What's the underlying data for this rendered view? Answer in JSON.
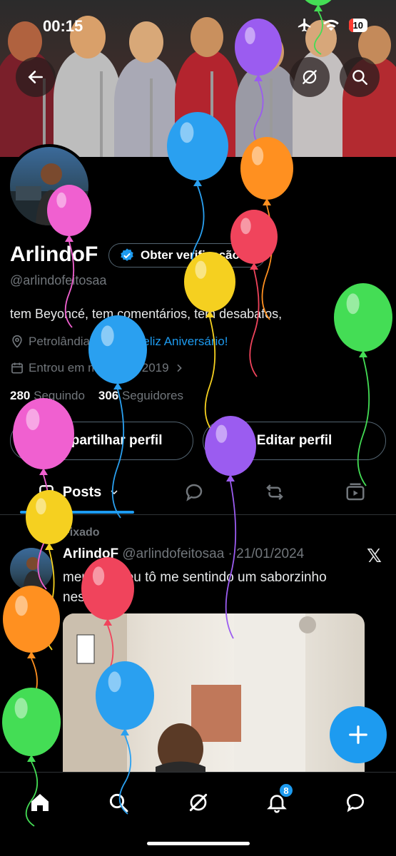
{
  "status_bar": {
    "time": "00:15",
    "battery": "10"
  },
  "profile": {
    "name": "ArlindoF",
    "verify_label": "Obter verificação",
    "handle": "@arlindofeitosaa",
    "bio": "tem Beyoncé, tem comentários, tem desabafos,",
    "location": "Petrolândia",
    "birthday": "Feliz Aniversário!",
    "joined": "Entrou em março de 2019",
    "following_count": "280",
    "following_label": "Seguindo",
    "followers_count": "306",
    "followers_label": "Seguidores"
  },
  "actions": {
    "share": "Compartilhar perfil",
    "edit": "Editar perfil"
  },
  "tabs": {
    "posts": "Posts"
  },
  "post": {
    "pinned_label": "Fixado",
    "author": "ArlindoF",
    "handle_date": "@arlindofeitosaa · 21/01/2024",
    "text": "meu deus eu tô me sentindo um saborzinho nesse"
  },
  "notifications": {
    "badge": "8"
  },
  "colors": {
    "accent": "#1d9bf0",
    "background": "#000000",
    "muted": "#71767b"
  },
  "balloons": [
    {
      "color": "#44dd55"
    },
    {
      "color": "#9b5cf0"
    },
    {
      "color": "#2aa0f0"
    },
    {
      "color": "#ff9020"
    },
    {
      "color": "#f060d0"
    },
    {
      "color": "#f0445c"
    },
    {
      "color": "#f5d020"
    },
    {
      "color": "#44dd55"
    },
    {
      "color": "#2aa0f0"
    },
    {
      "color": "#f060d0"
    },
    {
      "color": "#9b5cf0"
    },
    {
      "color": "#f5d020"
    },
    {
      "color": "#f0445c"
    },
    {
      "color": "#ff9020"
    },
    {
      "color": "#2aa0f0"
    },
    {
      "color": "#44dd55"
    }
  ]
}
